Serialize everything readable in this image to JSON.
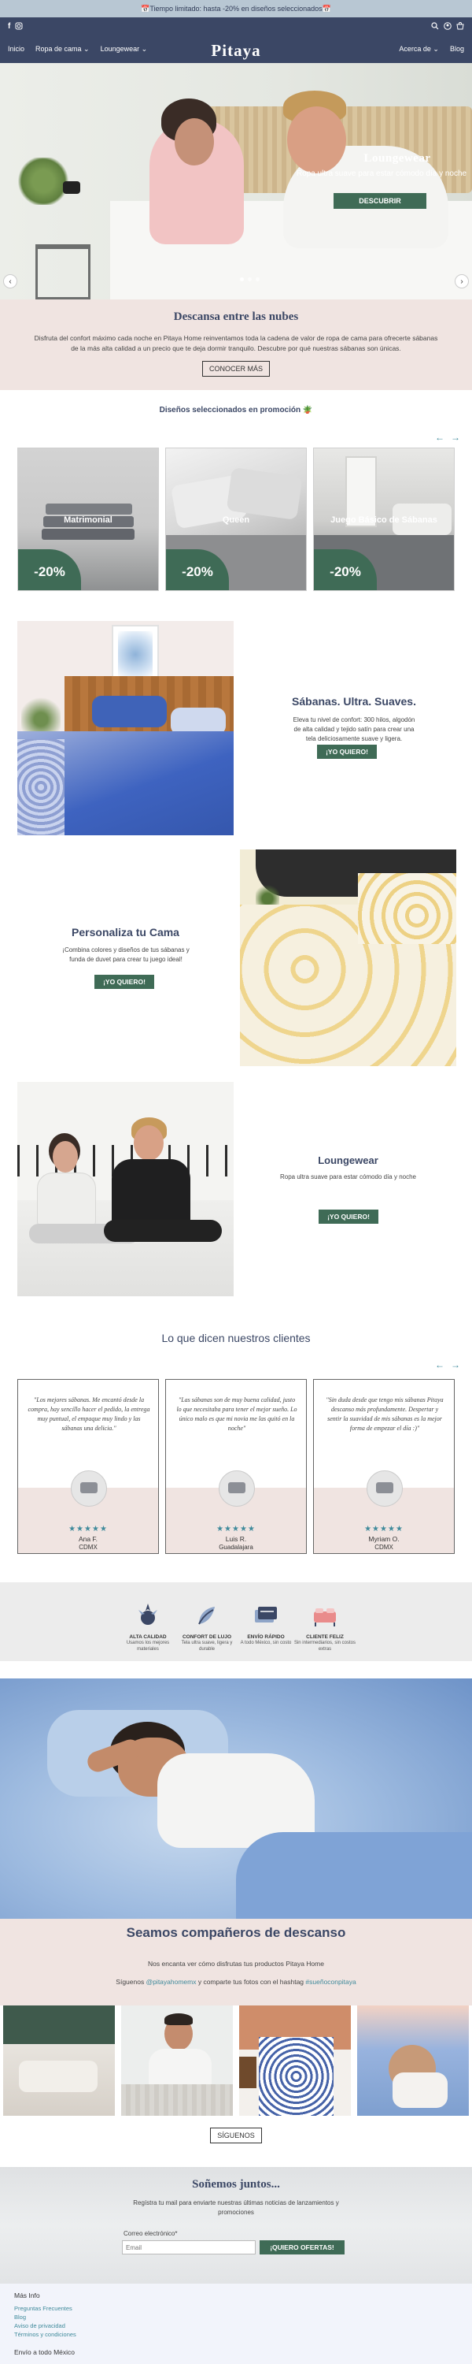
{
  "announcement": {
    "text": "📅Tiempo limitado: hasta -20% en diseños seleccionados📅"
  },
  "header": {
    "logo": "Pitaya",
    "nav_left": [
      "Inicio",
      "Ropa de cama ⌄",
      "Loungewear ⌄"
    ],
    "nav_right": [
      "Acerca de ⌄",
      "Blog"
    ],
    "social_icons": [
      "facebook-icon",
      "instagram-icon"
    ],
    "utility_icons": [
      "search-icon",
      "account-icon",
      "cart-icon"
    ],
    "color": "#3b4765"
  },
  "hero": {
    "title": "Loungewear",
    "subtitle": "Ropa ultra suave para estar cómodo día y noche",
    "button": "DESCUBRIR",
    "prev": "‹",
    "next": "›"
  },
  "intro": {
    "title": "Descansa entre las nubes",
    "text": "Disfruta del confort máximo cada noche en Pitaya Home reinventamos toda la cadena de valor de ropa de cama para ofrecerte sábanas de la más alta calidad a un precio que te deja dormir tranquilo. Descubre por qué nuestras sábanas son únicas.",
    "button": "CONOCER MÁS"
  },
  "promo": {
    "title": "Diseños seleccionados en promoción 🪴",
    "prev": "←",
    "next": "→",
    "cards": [
      {
        "label": "Matrimonial",
        "badge": "-20%"
      },
      {
        "label": "Queen",
        "badge": "-20%"
      },
      {
        "label": "Juego Básico de Sábanas",
        "badge": "-20%"
      }
    ]
  },
  "feature_sabanas": {
    "title": "Sábanas. Ultra. Suaves.",
    "text": "Eleva tu nivel de confort: 300 hilos, algodón de alta calidad y tejido satín para crear una tela deliciosamente suave y ligera.",
    "button": "¡YO QUIERO!"
  },
  "feature_personaliza": {
    "title": "Personaliza tu Cama",
    "text": "¡Combina colores y diseños de tus sábanas y funda de duvet para crear tu juego ideal!",
    "button": "¡YO QUIERO!"
  },
  "feature_loungewear": {
    "title": "Loungewear",
    "text": "Ropa ultra suave para estar cómodo día y noche",
    "button": "¡YO QUIERO!"
  },
  "testimonials": {
    "title": "Lo que dicen nuestros clientes",
    "prev": "←",
    "next": "→",
    "items": [
      {
        "quote": "\"Los mejores sábanas. Me encantó desde la compra, hay sencillo hacer el pedido, la entrega muy puntual, el empaque muy lindo y las sábanas una delicia.\"",
        "stars": "★★★★★",
        "name": "Ana F.",
        "city": "CDMX"
      },
      {
        "quote": "\"Las sábanas son de muy buena calidad, justo lo que necesitaba para tener el mejor sueño. Lo único malo es que mi novia me las quitó en la noche\"",
        "stars": "★★★★★",
        "name": "Luis R.",
        "city": "Guadalajara"
      },
      {
        "quote": "\"Sin duda desde que tengo mis sábanas Pitaya descanso más profundamente. Despertar y sentir la suavidad de mis sábanas es la mejor forma de empezar el día :)\"",
        "stars": "★★★★★",
        "name": "Myriam O.",
        "city": "CDMX"
      }
    ]
  },
  "benefits": [
    {
      "icon": "quality-icon",
      "title": "ALTA CALIDAD",
      "desc": "Usamos los mejores materiales"
    },
    {
      "icon": "comfort-icon",
      "title": "CONFORT DE LUJO",
      "desc": "Tela ultra suave, ligera y durable"
    },
    {
      "icon": "shipping-icon",
      "title": "ENVÍO RÁPIDO",
      "desc": "A todo México, sin costo"
    },
    {
      "icon": "happy-client-icon",
      "title": "CLIENTE FELIZ",
      "desc": "Sin intermediarios, sin costos extras"
    }
  ],
  "companions": {
    "title": "Seamos compañeros de descanso",
    "line1": "Nos encanta ver cómo disfrutas tus productos Pitaya Home",
    "line2_prefix": "Síguenos ",
    "handle": "@pitayahomemx",
    "line2_mid": " y comparte tus fotos con el hashtag ",
    "hashtag": "#sueñoconpitaya",
    "button": "SÍGUENOS"
  },
  "newsletter": {
    "title": "Soñemos juntos...",
    "text": "Regístra tu mail para enviarte nuestras últimas noticias de lanzamientos y promociones",
    "label": "Correo electrónico*",
    "placeholder": "Email",
    "button": "¡QUIERO OFERTAS!"
  },
  "footer": {
    "heading": "Más Info",
    "links": [
      "Preguntas Frecuentes",
      "Blog",
      "Aviso de privacidad",
      "Términos y condiciones"
    ],
    "shipping": "Envío a todo México"
  },
  "colors": {
    "navy": "#3b4765",
    "green": "#3f6b56",
    "teal": "#3f8a9b",
    "blush": "#f0e4e1"
  }
}
